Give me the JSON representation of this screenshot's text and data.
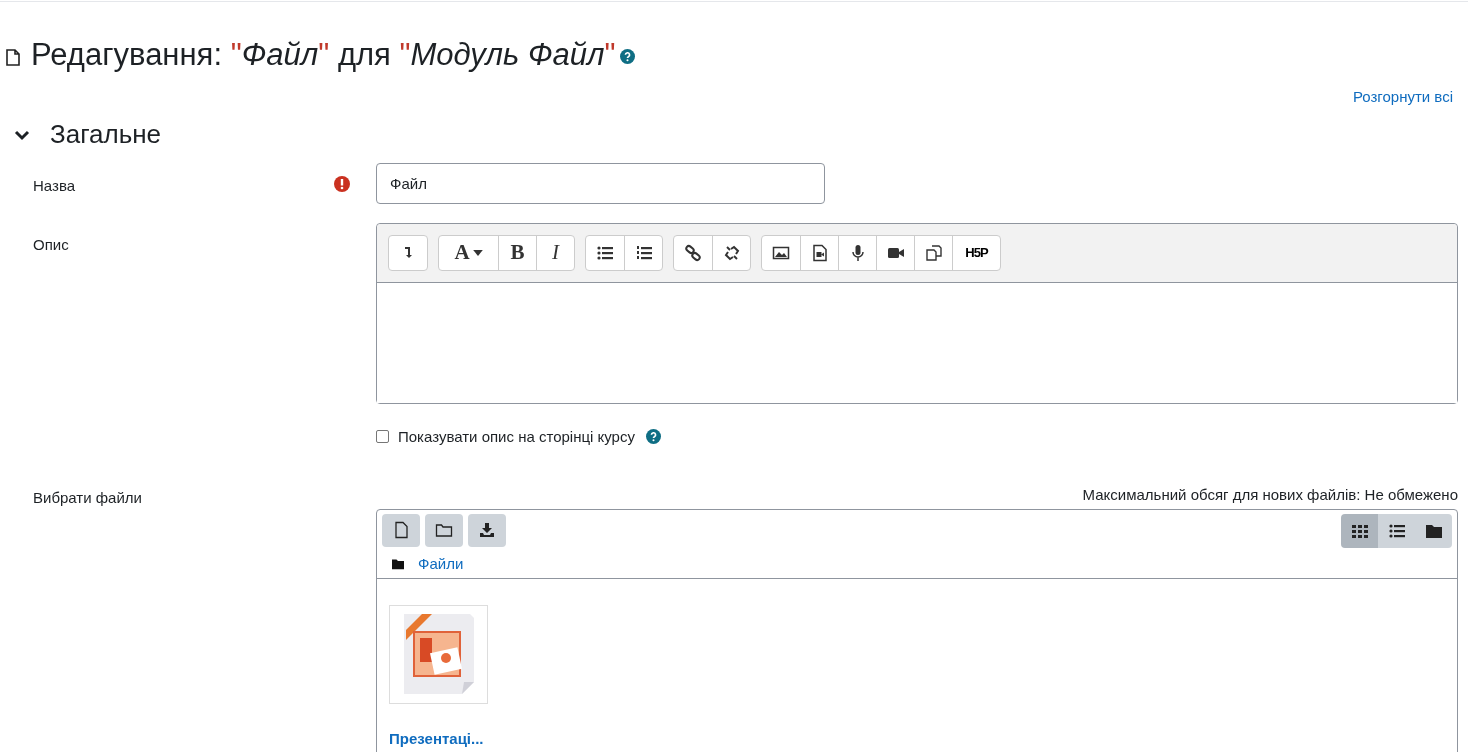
{
  "heading": {
    "parts": [
      {
        "kind": "plain",
        "text": "Редагування: "
      },
      {
        "kind": "quote",
        "text": "\""
      },
      {
        "kind": "em",
        "text": "Файл"
      },
      {
        "kind": "quote",
        "text": "\""
      },
      {
        "kind": "plain",
        "text": " для "
      },
      {
        "kind": "quote",
        "text": "\""
      },
      {
        "kind": "em",
        "text": "Модуль Файл"
      },
      {
        "kind": "quote",
        "text": "\""
      }
    ]
  },
  "expand_all": "Розгорнути всі",
  "section": {
    "title": "Загальне",
    "expanded": true
  },
  "name_field": {
    "label": "Назва",
    "value": "Файл",
    "required": true
  },
  "description": {
    "label": "Опис",
    "toolbar": [
      [
        {
          "kind": "collapse"
        }
      ],
      [
        {
          "kind": "font",
          "text": "A"
        },
        {
          "kind": "bold",
          "text": "B"
        },
        {
          "kind": "italic",
          "text": "I"
        }
      ],
      [
        {
          "kind": "bullets"
        },
        {
          "kind": "numbers"
        }
      ],
      [
        {
          "kind": "link"
        },
        {
          "kind": "unlink"
        }
      ],
      [
        {
          "kind": "image"
        },
        {
          "kind": "media"
        },
        {
          "kind": "mic"
        },
        {
          "kind": "video"
        },
        {
          "kind": "paste"
        },
        {
          "kind": "h5p",
          "text": "H5P"
        }
      ]
    ]
  },
  "show_description": {
    "label": "Показувати опис на сторінці курсу",
    "checked": false
  },
  "files": {
    "label": "Вибрати файли",
    "limit": "Максимальний обсяг для нових файлів: Не обмежено",
    "path": "Файли",
    "views": [
      {
        "kind": "grid",
        "selected": true
      },
      {
        "kind": "list",
        "selected": false
      },
      {
        "kind": "tree",
        "selected": false
      }
    ],
    "items": [
      {
        "name": "Презентаці..."
      }
    ]
  }
}
